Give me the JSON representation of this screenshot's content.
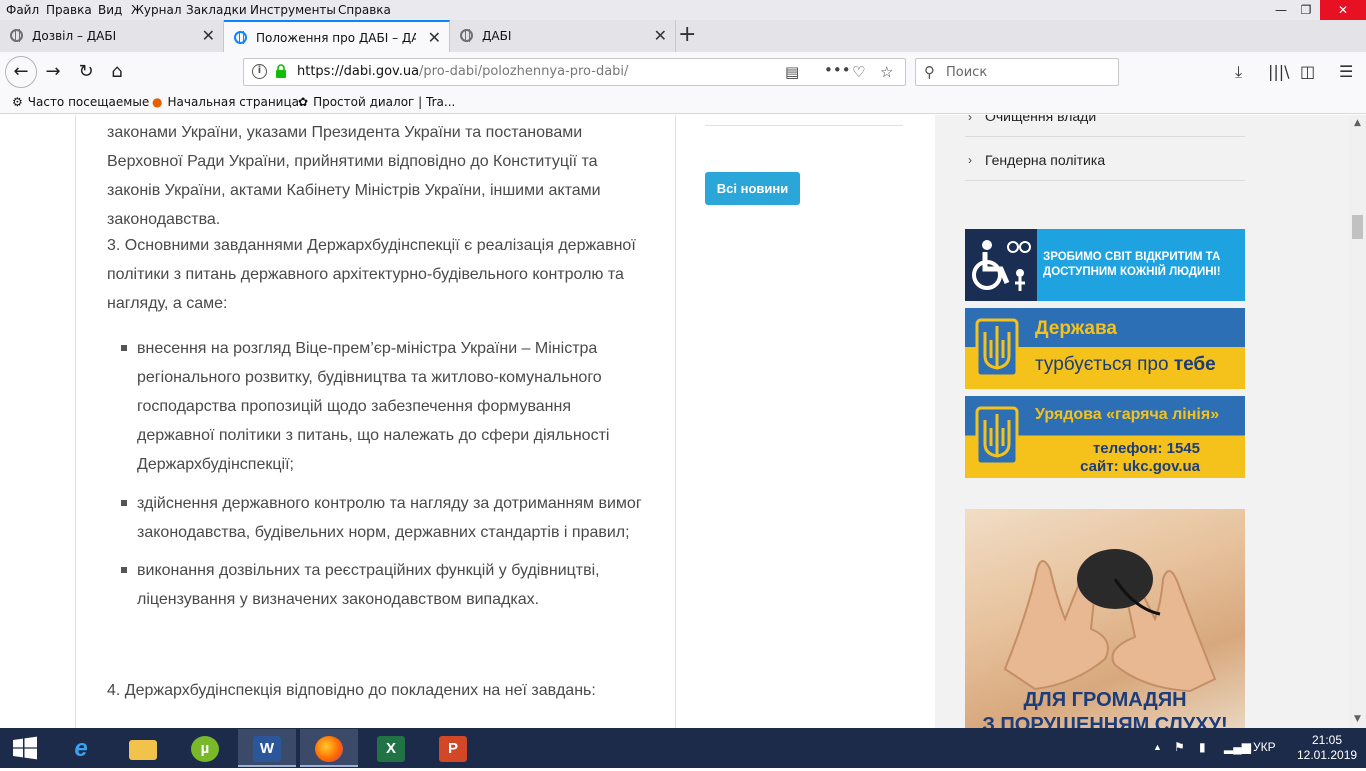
{
  "menubar": {
    "items": [
      "Файл",
      "Правка",
      "Вид",
      "Журнал",
      "Закладки",
      "Инструменты",
      "Справка"
    ]
  },
  "tabs": [
    {
      "title": "Дозвіл – ДАБІ",
      "active": false
    },
    {
      "title": "Положення про ДАБІ – ДАБІ",
      "active": true
    },
    {
      "title": "ДАБІ",
      "active": false
    }
  ],
  "navbar": {
    "url_host": "https://dabi.gov.ua",
    "url_path": "/pro-dabi/polozhennya-pro-dabi/",
    "search_placeholder": "Поиск"
  },
  "bookmarks": [
    {
      "label": "Часто посещаемые",
      "icon": "gear-icon"
    },
    {
      "label": "Начальная страница",
      "icon": "firefox-icon"
    },
    {
      "label": "Простой диалог | Tra...",
      "icon": "chat-icon"
    }
  ],
  "article": {
    "para_intro": "законами України, указами Президента України та постановами Верховної Ради України, прийнятими відповідно до Конституції та законів України, актами Кабінету Міністрів України, іншими актами законодавства.",
    "para_3": "3. Основними завданнями Держархбудінспекції є реалізація державної політики з питань державного архітектурно-будівельного контролю та нагляду, а саме:",
    "bullets": [
      "внесення на розгляд Віце-прем’єр-міністра України – Міністра регіонального розвитку, будівництва та житлово-комунального господарства пропозицій щодо забезпечення формування державної політики з питань, що належать до сфери діяльності Держархбудінспекції;",
      "здійснення державного контролю та нагляду за дотриманням вимог законодавства, будівельних норм, державних стандартів і правил;",
      "виконання дозвільних та реєстраційних функцій у будівництві, ліцензування у визначених законодавством випадках."
    ],
    "para_4": "4. Держархбудінспекція відповідно до покладених на неї завдань:"
  },
  "middle": {
    "all_news_label": "Всі новини"
  },
  "sidebar": {
    "links": [
      "Очищення влади",
      "Гендерна політика"
    ],
    "banner_access": "ЗРОБИМО СВІТ ВІДКРИТИМ ТА ДОСТУПНИМ КОЖНІЙ ЛЮДИНІ!",
    "banner_state_title": "Держава",
    "banner_state_sub": "турбується про",
    "banner_state_sub_bold": "тебе",
    "banner_hotline_title": "Урядова «гаряча лінія»",
    "banner_hotline_phone": "телефон: 1545",
    "banner_hotline_site": "сайт: ukc.gov.ua",
    "banner_deaf_line1": "ДЛЯ ГРОМАДЯН",
    "banner_deaf_line2": "З ПОРУШЕННЯМ СЛУХУ!"
  },
  "taskbar": {
    "apps": [
      "internet-explorer-icon",
      "file-explorer-icon",
      "utorrent-icon",
      "word-icon",
      "firefox-icon",
      "excel-icon",
      "powerpoint-icon"
    ],
    "language": "УКР",
    "time": "21:05",
    "date": "12.01.2019"
  },
  "colors": {
    "accent_blue": "#0a84ff",
    "button_blue": "#2aa6d8",
    "flag_blue": "#2d6fb5",
    "flag_yellow": "#f4c21a",
    "taskbar": "#1c2b4a"
  }
}
